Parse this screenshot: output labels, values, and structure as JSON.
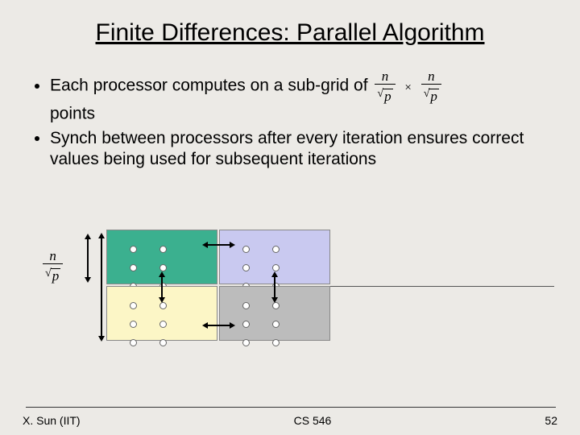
{
  "title": "Finite Differences: Parallel Algorithm",
  "bullets": {
    "b1_prefix": "Each processor computes on a sub-grid of ",
    "b1_suffix": " points",
    "b2": "Synch between processors after every iteration ensures correct values being used for subsequent iterations"
  },
  "math": {
    "n": "n",
    "p": "p",
    "times": "×"
  },
  "footer": {
    "left": "X. Sun (IIT)",
    "center": "CS 546",
    "right": "52"
  }
}
